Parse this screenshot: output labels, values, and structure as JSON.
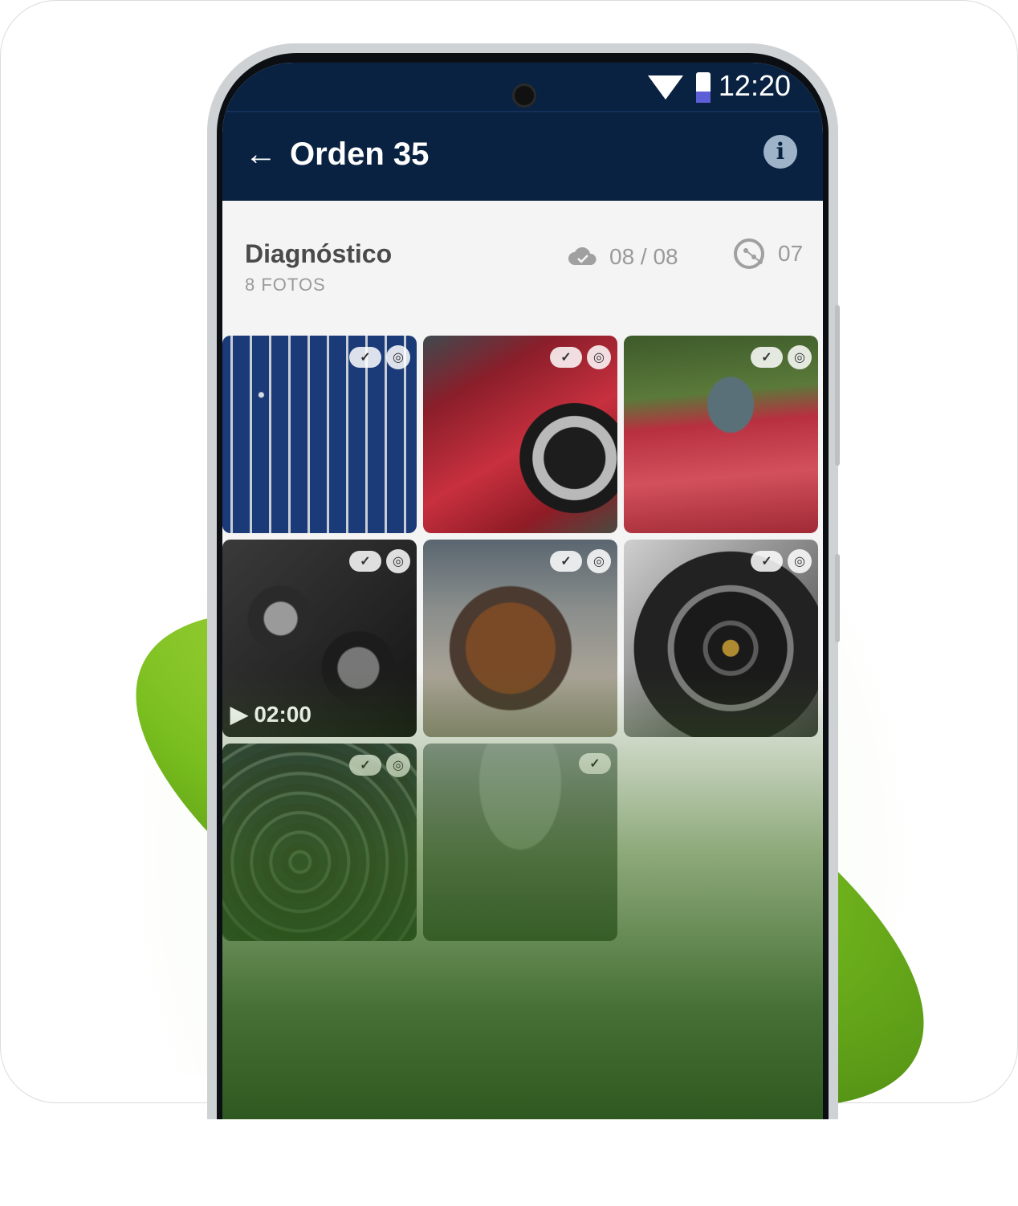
{
  "status_bar": {
    "time": "12:20"
  },
  "app_bar": {
    "back_glyph": "←",
    "title": "Orden 35",
    "info_glyph": "i"
  },
  "section": {
    "title": "Diagnóstico",
    "subtitle": "8 FOTOS",
    "uploaded": "08 / 08",
    "ai_count": "07"
  },
  "tiles": [
    {
      "subject": "wrenches-on-wall",
      "uploaded": true,
      "ai": true,
      "video_duration": ""
    },
    {
      "subject": "damaged-red-car-door",
      "uploaded": true,
      "ai": true,
      "video_duration": ""
    },
    {
      "subject": "damaged-red-car-side",
      "uploaded": true,
      "ai": true,
      "video_duration": ""
    },
    {
      "subject": "engine-bay-grayscale",
      "uploaded": true,
      "ai": true,
      "video_duration": "02:00"
    },
    {
      "subject": "rusty-engine-on-stand",
      "uploaded": true,
      "ai": true,
      "video_duration": ""
    },
    {
      "subject": "sports-wheel",
      "uploaded": true,
      "ai": true,
      "video_duration": ""
    },
    {
      "subject": "engine-hoses",
      "uploaded": true,
      "ai": true,
      "video_duration": ""
    },
    {
      "subject": "cracked-windshield",
      "uploaded": true,
      "ai": false,
      "video_duration": ""
    }
  ],
  "colors": {
    "app_bar": "#0a2242",
    "accent_green": "#78bd1e",
    "screen_bg": "#f4f4f4"
  }
}
